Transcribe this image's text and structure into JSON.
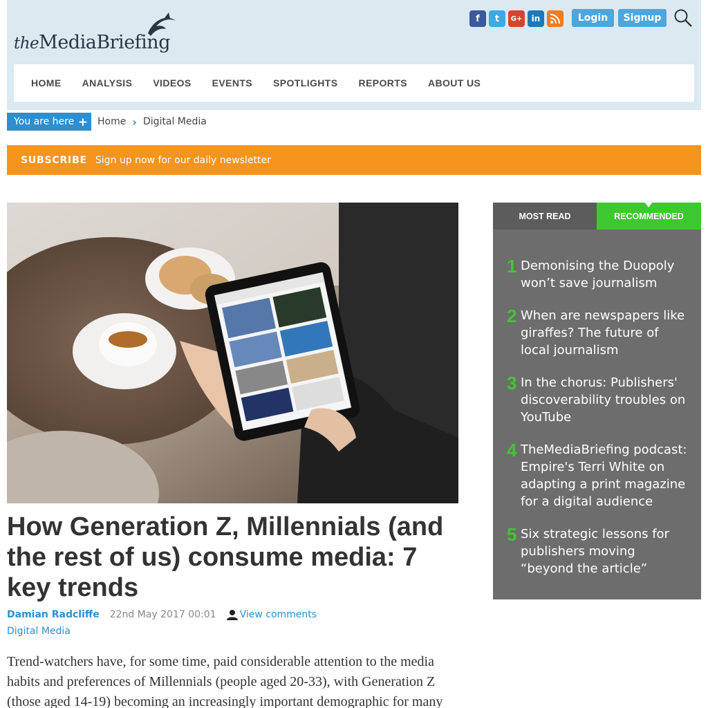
{
  "header": {
    "logo": {
      "prefix": "the",
      "name": "MediaBriefing"
    },
    "social": [
      "facebook-icon",
      "twitter-icon",
      "google-plus-icon",
      "linkedin-icon",
      "rss-icon"
    ],
    "social_glyphs": {
      "facebook": "f",
      "twitter": "t",
      "google": "G+",
      "linkedin": "in",
      "rss": "⌁"
    },
    "login_label": "Login",
    "signup_label": "Signup"
  },
  "nav": {
    "items": [
      "HOME",
      "ANALYSIS",
      "VIDEOS",
      "EVENTS",
      "SPOTLIGHTS",
      "REPORTS",
      "ABOUT US"
    ]
  },
  "breadcrumb": {
    "you_are_here": "You are here",
    "plus": "+",
    "separator": "›",
    "items": [
      "Home",
      "Digital Media"
    ]
  },
  "subscribe": {
    "label": "SUBSCRIBE",
    "text": "Sign up now for our daily newsletter"
  },
  "article": {
    "title": "How Generation Z, Millennials (and the rest of us) consume media: 7 key trends",
    "author": "Damian Radcliffe",
    "date": "22nd May 2017 00:01",
    "comments_label": "View comments",
    "category": "Digital Media",
    "body": "Trend-watchers have, for some time, paid considerable attention to the media habits and preferences of Millennials (people aged 20-33), with Generation Z (those aged 14-19) becoming an increasingly important demographic for many"
  },
  "sidebar": {
    "tabs": {
      "most_read": "MOST READ",
      "recommended": "RECOMMENDED"
    },
    "items": [
      {
        "num": "1",
        "text": "Demonising the Duopoly won’t save journalism"
      },
      {
        "num": "2",
        "text": "When are newspapers like giraffes? The future of local journalism"
      },
      {
        "num": "3",
        "text": "In the chorus: Publishers' discoverability troubles on YouTube"
      },
      {
        "num": "4",
        "text": "TheMediaBriefing podcast: Empire's Terri White on adapting a print magazine for a digital audience"
      },
      {
        "num": "5",
        "text": "Six strategic lessons for publishers moving “beyond the article”"
      }
    ]
  },
  "colors": {
    "header_bg": "#dbe9f1",
    "accent_blue": "#2d8fcf",
    "subscribe_orange": "#f7941d",
    "sidebar_grey": "#6d6d6d",
    "accent_green": "#3ec82f"
  }
}
